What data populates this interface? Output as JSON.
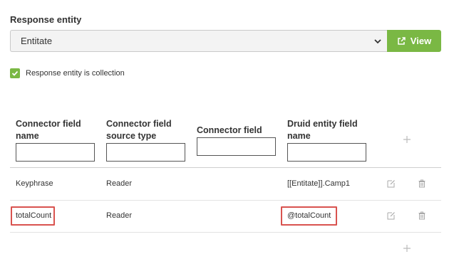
{
  "section": {
    "label": "Response entity"
  },
  "select": {
    "value": "Entitate"
  },
  "view_button": {
    "label": "View"
  },
  "checkbox": {
    "label": "Response entity is collection",
    "checked": true
  },
  "table": {
    "headers": [
      "Connector field name",
      "Connector field source type",
      "Connector field type",
      "Druid entity field name"
    ],
    "rows": [
      {
        "field_name": "Keyphrase",
        "source_type": "Reader",
        "entity_field": "[[Entitate]].Camp1",
        "highlighted": false
      },
      {
        "field_name": "totalCount",
        "source_type": "Reader",
        "entity_field": "@totalCount",
        "highlighted": true
      }
    ]
  },
  "colors": {
    "accent_green": "#7ab844",
    "highlight_red": "#d9534f",
    "divider": "#dddddd"
  },
  "icons": [
    "chevron-down-icon",
    "external-link-icon",
    "checkmark-icon",
    "plus-icon",
    "edit-icon",
    "trash-icon"
  ]
}
